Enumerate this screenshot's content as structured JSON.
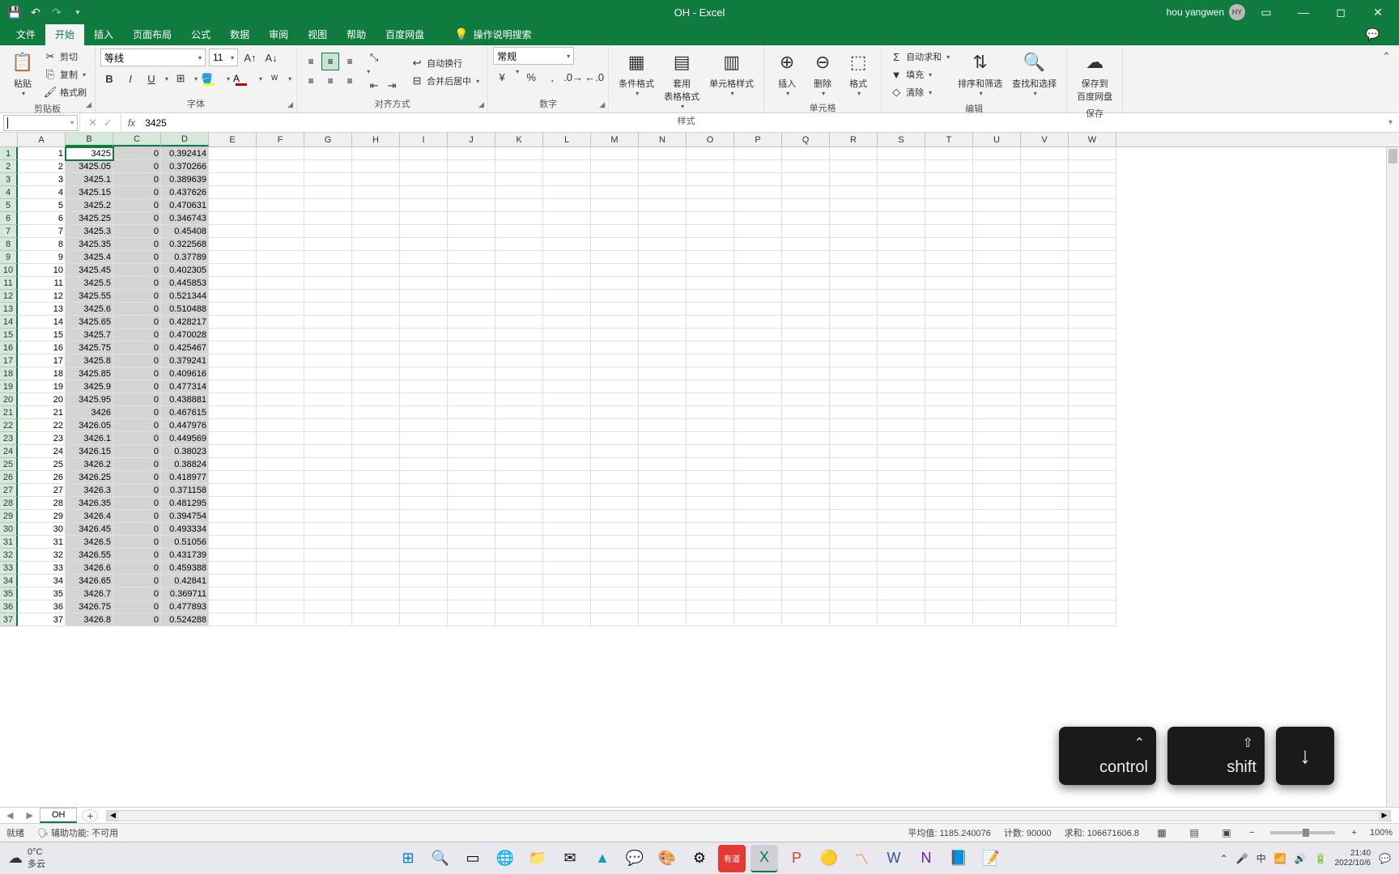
{
  "title": "OH  -  Excel",
  "user": {
    "name": "hou yangwen",
    "initials": "HY"
  },
  "tabs": [
    "文件",
    "开始",
    "插入",
    "页面布局",
    "公式",
    "数据",
    "审阅",
    "视图",
    "帮助",
    "百度网盘"
  ],
  "active_tab": "开始",
  "tell_me": "操作说明搜索",
  "ribbon": {
    "clipboard": {
      "paste": "粘贴",
      "cut": "剪切",
      "copy": "复制",
      "format_painter": "格式刷",
      "label": "剪贴板"
    },
    "font": {
      "name": "等线",
      "size": "11",
      "label": "字体"
    },
    "alignment": {
      "wrap": "自动换行",
      "merge": "合并后居中",
      "label": "对齐方式"
    },
    "number": {
      "format": "常规",
      "label": "数字"
    },
    "styles": {
      "conditional": "条件格式",
      "table": "套用\n表格格式",
      "cell": "单元格样式",
      "label": "样式"
    },
    "cells": {
      "insert": "插入",
      "delete": "删除",
      "format": "格式",
      "label": "单元格"
    },
    "editing": {
      "autosum": "自动求和",
      "fill": "填充",
      "clear": "清除",
      "sort": "排序和筛选",
      "find": "查找和选择",
      "label": "编辑"
    },
    "save_cloud": {
      "label1": "保存到",
      "label2": "百度网盘",
      "group_label": "保存"
    }
  },
  "name_box": "",
  "formula_value": "3425",
  "columns": [
    "A",
    "B",
    "C",
    "D",
    "E",
    "F",
    "G",
    "H",
    "I",
    "J",
    "K",
    "L",
    "M",
    "N",
    "O",
    "P",
    "Q",
    "R",
    "S",
    "T",
    "U",
    "V",
    "W"
  ],
  "selected_cols": [
    "B",
    "C",
    "D"
  ],
  "sheet_data": [
    {
      "r": 1,
      "A": "1",
      "B": "3425",
      "C": "0",
      "D": "0.392414"
    },
    {
      "r": 2,
      "A": "2",
      "B": "3425.05",
      "C": "0",
      "D": "0.370266"
    },
    {
      "r": 3,
      "A": "3",
      "B": "3425.1",
      "C": "0",
      "D": "0.389639"
    },
    {
      "r": 4,
      "A": "4",
      "B": "3425.15",
      "C": "0",
      "D": "0.437626"
    },
    {
      "r": 5,
      "A": "5",
      "B": "3425.2",
      "C": "0",
      "D": "0.470631"
    },
    {
      "r": 6,
      "A": "6",
      "B": "3425.25",
      "C": "0",
      "D": "0.346743"
    },
    {
      "r": 7,
      "A": "7",
      "B": "3425.3",
      "C": "0",
      "D": "0.45408"
    },
    {
      "r": 8,
      "A": "8",
      "B": "3425.35",
      "C": "0",
      "D": "0.322568"
    },
    {
      "r": 9,
      "A": "9",
      "B": "3425.4",
      "C": "0",
      "D": "0.37789"
    },
    {
      "r": 10,
      "A": "10",
      "B": "3425.45",
      "C": "0",
      "D": "0.402305"
    },
    {
      "r": 11,
      "A": "11",
      "B": "3425.5",
      "C": "0",
      "D": "0.445853"
    },
    {
      "r": 12,
      "A": "12",
      "B": "3425.55",
      "C": "0",
      "D": "0.521344"
    },
    {
      "r": 13,
      "A": "13",
      "B": "3425.6",
      "C": "0",
      "D": "0.510488"
    },
    {
      "r": 14,
      "A": "14",
      "B": "3425.65",
      "C": "0",
      "D": "0.428217"
    },
    {
      "r": 15,
      "A": "15",
      "B": "3425.7",
      "C": "0",
      "D": "0.470028"
    },
    {
      "r": 16,
      "A": "16",
      "B": "3425.75",
      "C": "0",
      "D": "0.425467"
    },
    {
      "r": 17,
      "A": "17",
      "B": "3425.8",
      "C": "0",
      "D": "0.379241"
    },
    {
      "r": 18,
      "A": "18",
      "B": "3425.85",
      "C": "0",
      "D": "0.409616"
    },
    {
      "r": 19,
      "A": "19",
      "B": "3425.9",
      "C": "0",
      "D": "0.477314"
    },
    {
      "r": 20,
      "A": "20",
      "B": "3425.95",
      "C": "0",
      "D": "0.438881"
    },
    {
      "r": 21,
      "A": "21",
      "B": "3426",
      "C": "0",
      "D": "0.467615"
    },
    {
      "r": 22,
      "A": "22",
      "B": "3426.05",
      "C": "0",
      "D": "0.447976"
    },
    {
      "r": 23,
      "A": "23",
      "B": "3426.1",
      "C": "0",
      "D": "0.449569"
    },
    {
      "r": 24,
      "A": "24",
      "B": "3426.15",
      "C": "0",
      "D": "0.38023"
    },
    {
      "r": 25,
      "A": "25",
      "B": "3426.2",
      "C": "0",
      "D": "0.38824"
    },
    {
      "r": 26,
      "A": "26",
      "B": "3426.25",
      "C": "0",
      "D": "0.418977"
    },
    {
      "r": 27,
      "A": "27",
      "B": "3426.3",
      "C": "0",
      "D": "0.371158"
    },
    {
      "r": 28,
      "A": "28",
      "B": "3426.35",
      "C": "0",
      "D": "0.481295"
    },
    {
      "r": 29,
      "A": "29",
      "B": "3426.4",
      "C": "0",
      "D": "0.394754"
    },
    {
      "r": 30,
      "A": "30",
      "B": "3426.45",
      "C": "0",
      "D": "0.493334"
    },
    {
      "r": 31,
      "A": "31",
      "B": "3426.5",
      "C": "0",
      "D": "0.51056"
    },
    {
      "r": 32,
      "A": "32",
      "B": "3426.55",
      "C": "0",
      "D": "0.431739"
    },
    {
      "r": 33,
      "A": "33",
      "B": "3426.6",
      "C": "0",
      "D": "0.459388"
    },
    {
      "r": 34,
      "A": "34",
      "B": "3426.65",
      "C": "0",
      "D": "0.42841"
    },
    {
      "r": 35,
      "A": "35",
      "B": "3426.7",
      "C": "0",
      "D": "0.369711"
    },
    {
      "r": 36,
      "A": "36",
      "B": "3426.75",
      "C": "0",
      "D": "0.477893"
    },
    {
      "r": 37,
      "A": "37",
      "B": "3426.8",
      "C": "0",
      "D": "0.524288"
    }
  ],
  "sheet_tab": "OH",
  "status": {
    "ready": "就绪",
    "accessibility": "辅助功能: 不可用",
    "average_label": "平均值:",
    "average_value": "1185.240076",
    "count_label": "计数:",
    "count_value": "90000",
    "sum_label": "求和:",
    "sum_value": "106671606.8",
    "zoom": "100%"
  },
  "taskbar": {
    "weather_temp": "0°C",
    "weather_desc": "多云",
    "time": "21:40",
    "date": "2022/10/6"
  },
  "keys": [
    "control",
    "shift",
    "↓"
  ]
}
